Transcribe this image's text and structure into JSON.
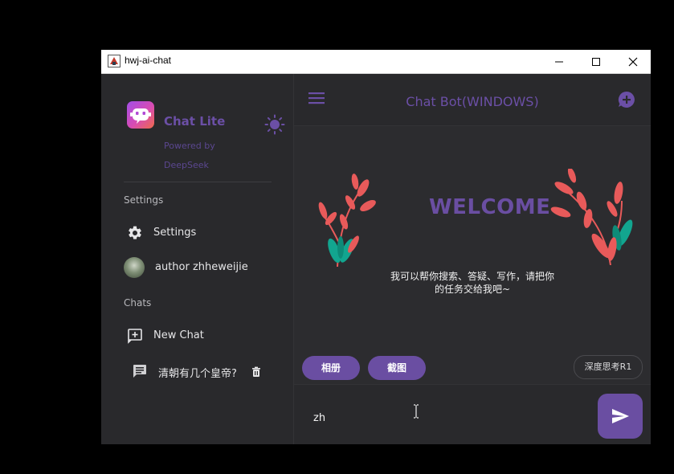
{
  "window": {
    "title": "hwj-ai-chat"
  },
  "sidebar": {
    "brand": {
      "name": "Chat Lite",
      "powered_by": "Powered by DeepSeek"
    },
    "sections": {
      "settings": "Settings",
      "chats": "Chats"
    },
    "items": [
      {
        "label": "Settings",
        "icon": "gear-icon"
      },
      {
        "label": "author zhheweijie",
        "icon": "avatar"
      },
      {
        "label": "New Chat",
        "icon": "add-chat-icon"
      },
      {
        "label": "清朝有几个皇帝?",
        "icon": "chat-bubble-icon"
      }
    ]
  },
  "header": {
    "title": "Chat Bot(WINDOWS)"
  },
  "welcome": {
    "heading": "WELCOME",
    "message": "我可以帮你搜索、答疑、写作，请把你的任务交给我吧~"
  },
  "actions": {
    "album": "相册",
    "screenshot": "截图",
    "deep_think": "深度思考R1"
  },
  "input": {
    "value": "zh"
  },
  "colors": {
    "accent": "#6a4ea2",
    "background": "#2b2b2e",
    "plant_red": "#e85a5a",
    "plant_teal": "#12a58f"
  }
}
